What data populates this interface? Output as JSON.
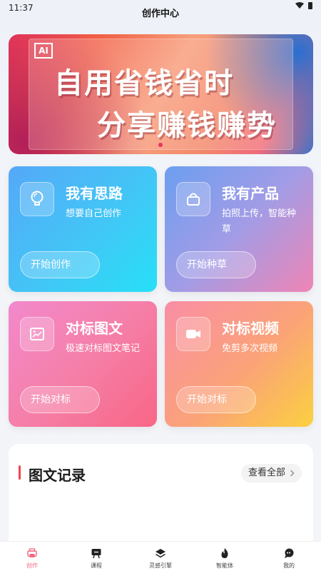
{
  "status_bar": {
    "time": "11:37"
  },
  "header": {
    "title": "创作中心"
  },
  "banner": {
    "badge": "AI",
    "line1": "自用省钱省时",
    "line2": "分享赚钱赚势"
  },
  "cards": [
    {
      "title": "我有思路",
      "desc": "想要自己创作",
      "button": "开始创作",
      "icon": "bulb-icon"
    },
    {
      "title": "我有产品",
      "desc": "拍照上传，智能种草",
      "button": "开始种草",
      "icon": "bag-icon"
    },
    {
      "title": "对标图文",
      "desc": "极速对标图文笔记",
      "button": "开始对标",
      "icon": "image-icon"
    },
    {
      "title": "对标视频",
      "desc": "免剪多次视频",
      "button": "开始对标",
      "icon": "video-icon"
    }
  ],
  "records": {
    "title": "图文记录",
    "view_all": "查看全部"
  },
  "tabbar": {
    "items": [
      {
        "label": "创作",
        "icon": "printer-icon",
        "active": true
      },
      {
        "label": "课程",
        "icon": "board-icon",
        "active": false
      },
      {
        "label": "灵感引擎",
        "icon": "layers-icon",
        "active": false
      },
      {
        "label": "智能体",
        "icon": "flame-icon",
        "active": false
      },
      {
        "label": "我的",
        "icon": "chat-icon",
        "active": false
      }
    ]
  },
  "colors": {
    "accent": "#f06a84",
    "record_bar": "#f0454f"
  }
}
